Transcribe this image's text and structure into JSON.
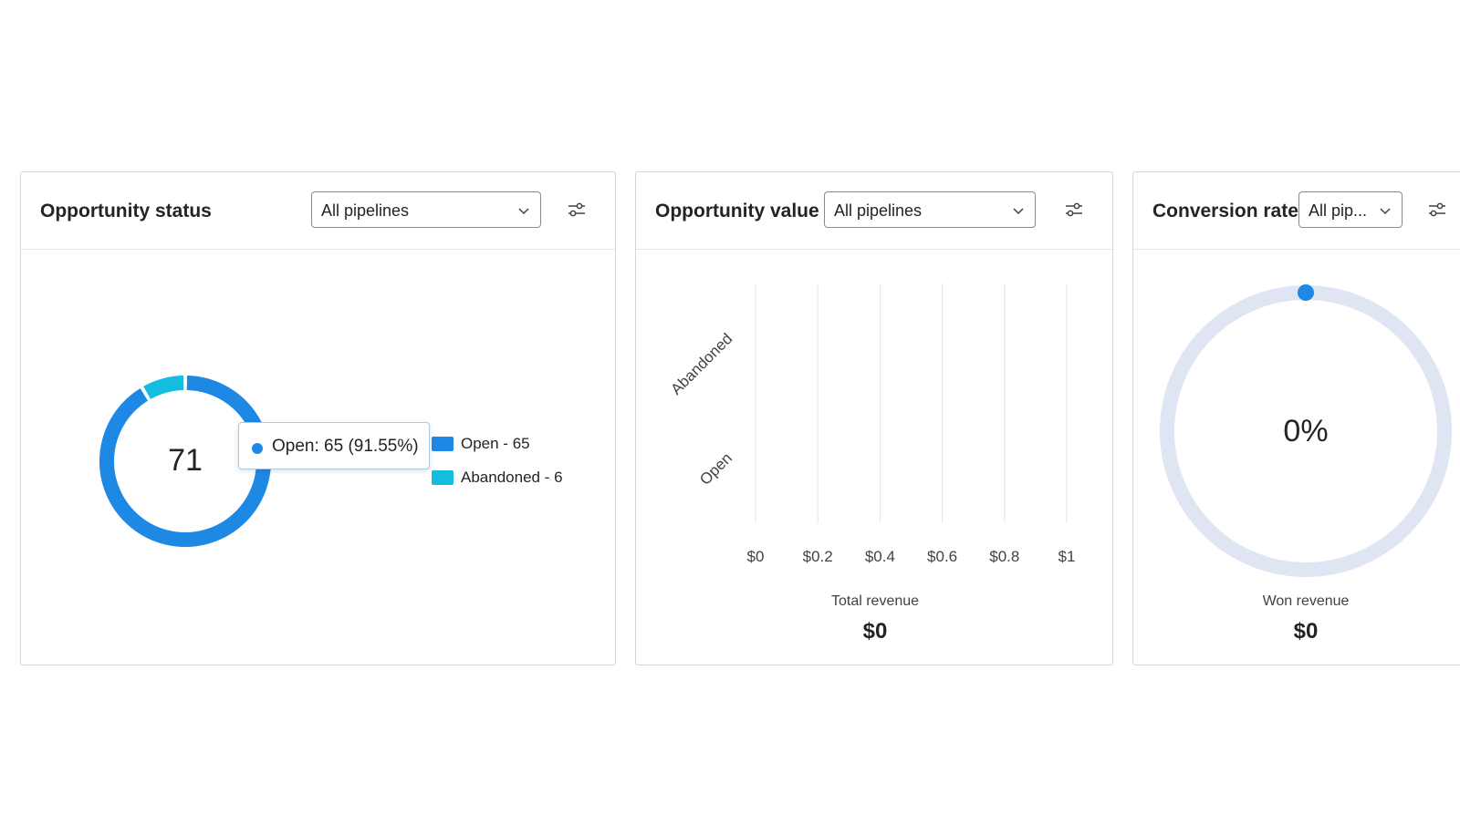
{
  "colors": {
    "open": "#1e88e5",
    "abandoned": "#12bde0",
    "track": "#dfe5f3",
    "accent": "#1e88e5"
  },
  "status_card": {
    "title": "Opportunity status",
    "pipeline_select": "All pipelines",
    "filter_icon": "filter-sliders-icon",
    "total": "71",
    "tooltip": "Open: 65 (91.55%)",
    "legend": [
      "Open - 65",
      "Abandoned - 6"
    ]
  },
  "value_card": {
    "title": "Opportunity value",
    "pipeline_select": "All pipelines",
    "filter_icon": "filter-sliders-icon",
    "total_label": "Total revenue",
    "total_value": "$0"
  },
  "conversion_card": {
    "title": "Conversion rate",
    "pipeline_select": "All pip...",
    "filter_icon": "filter-sliders-icon",
    "rate": "0%",
    "won_label": "Won revenue",
    "won_value": "$0"
  },
  "chart_data": [
    {
      "type": "pie",
      "categories": [
        "Open",
        "Abandoned"
      ],
      "values": [
        65,
        6
      ],
      "center_label": "71",
      "tooltip": "Open: 65 (91.55%)",
      "legend_position": "right"
    },
    {
      "type": "bar",
      "orientation": "horizontal",
      "categories": [
        "Abandoned",
        "Open"
      ],
      "values": [
        0,
        0
      ],
      "x_ticks": [
        "$0",
        "$0.2",
        "$0.4",
        "$0.6",
        "$0.8",
        "$1"
      ],
      "xlim": [
        0,
        1
      ],
      "grid": true
    },
    {
      "type": "pie",
      "values": [
        0
      ],
      "center_label": "0%"
    }
  ]
}
